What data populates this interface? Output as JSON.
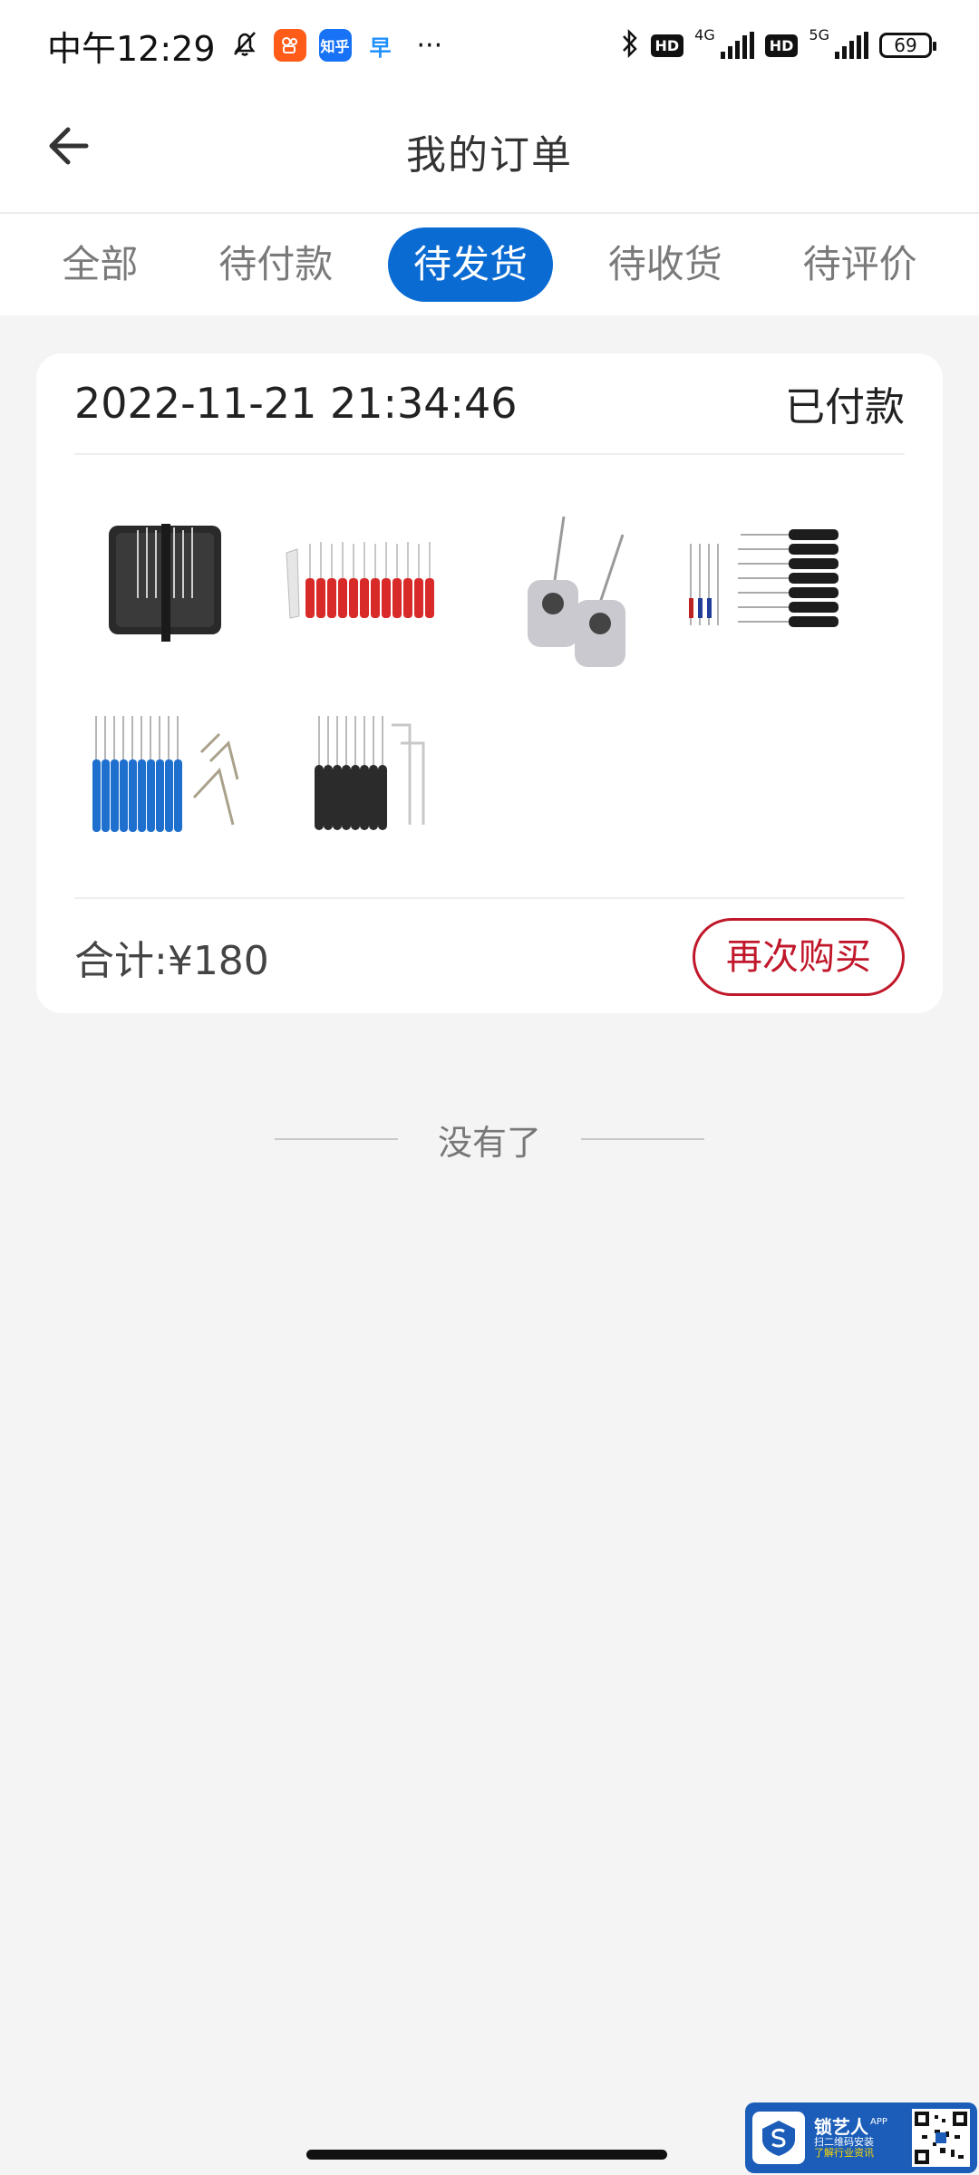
{
  "status_bar": {
    "time": "中午12:29",
    "apps": [
      "kuaishou-icon",
      "zhihu-icon",
      "app-icon"
    ],
    "zhihu_label": "知乎",
    "more": "···",
    "hd1": "HD",
    "net1": "4G",
    "hd2": "HD",
    "net2": "5G",
    "battery": "69"
  },
  "header": {
    "title": "我的订单",
    "back_icon": "arrow-left-icon"
  },
  "tabs": [
    {
      "label": "全部",
      "active": false
    },
    {
      "label": "待付款",
      "active": false
    },
    {
      "label": "待发货",
      "active": true
    },
    {
      "label": "待收货",
      "active": false
    },
    {
      "label": "待评价",
      "active": false
    }
  ],
  "order": {
    "datetime": "2022-11-21 21:34:46",
    "status": "已付款",
    "products": [
      "black-pouch-pick-set",
      "red-handle-pick-set",
      "silver-tag-tension-tools",
      "black-screwdriver-set",
      "blue-handle-pick-set",
      "black-handle-pick-set"
    ],
    "total": "合计:¥180",
    "rebuy_label": "再次购买"
  },
  "list_end": "没有了",
  "promo": {
    "name": "锁艺人",
    "app": "APP",
    "line1": "扫二维码安装",
    "line2": "了解行业资讯"
  },
  "colors": {
    "accent": "#0a6bd3",
    "rebuy": "#c0182a",
    "background": "#f4f4f4"
  }
}
